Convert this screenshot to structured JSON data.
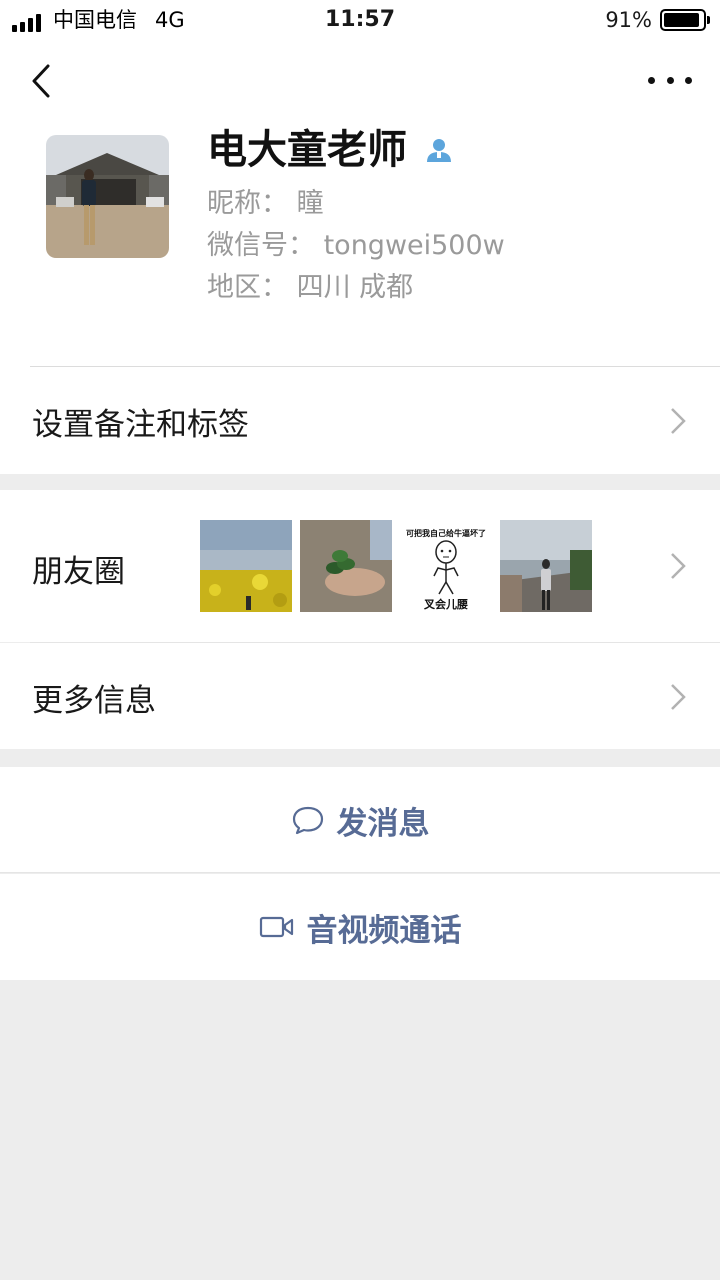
{
  "status_bar": {
    "carrier": "中国电信",
    "network": "4G",
    "time": "11:57",
    "battery_percent": "91%",
    "battery_level": 0.91
  },
  "profile": {
    "display_name": "电大童老师",
    "nickname_line": "昵称：  瞳",
    "wechat_id_line": "微信号：  tongwei500w",
    "region_line": "地区：  四川 成都"
  },
  "rows": {
    "remark_label": "设置备注和标签",
    "moments_label": "朋友圈",
    "more_info_label": "更多信息"
  },
  "moments_meme": {
    "top_text": "可把我自己给牛逼坏了",
    "bottom_text": "叉会儿腰"
  },
  "actions": {
    "send_message": "发消息",
    "video_call": "音视频通话"
  },
  "colors": {
    "link_blue": "#576b95",
    "background": "#ededed",
    "verified_icon": "#5ca5dc"
  },
  "icons": [
    "back-arrow-icon",
    "more-dots-icon",
    "contact-person-icon",
    "chevron-right-icon",
    "chat-bubble-icon",
    "video-camera-icon"
  ]
}
